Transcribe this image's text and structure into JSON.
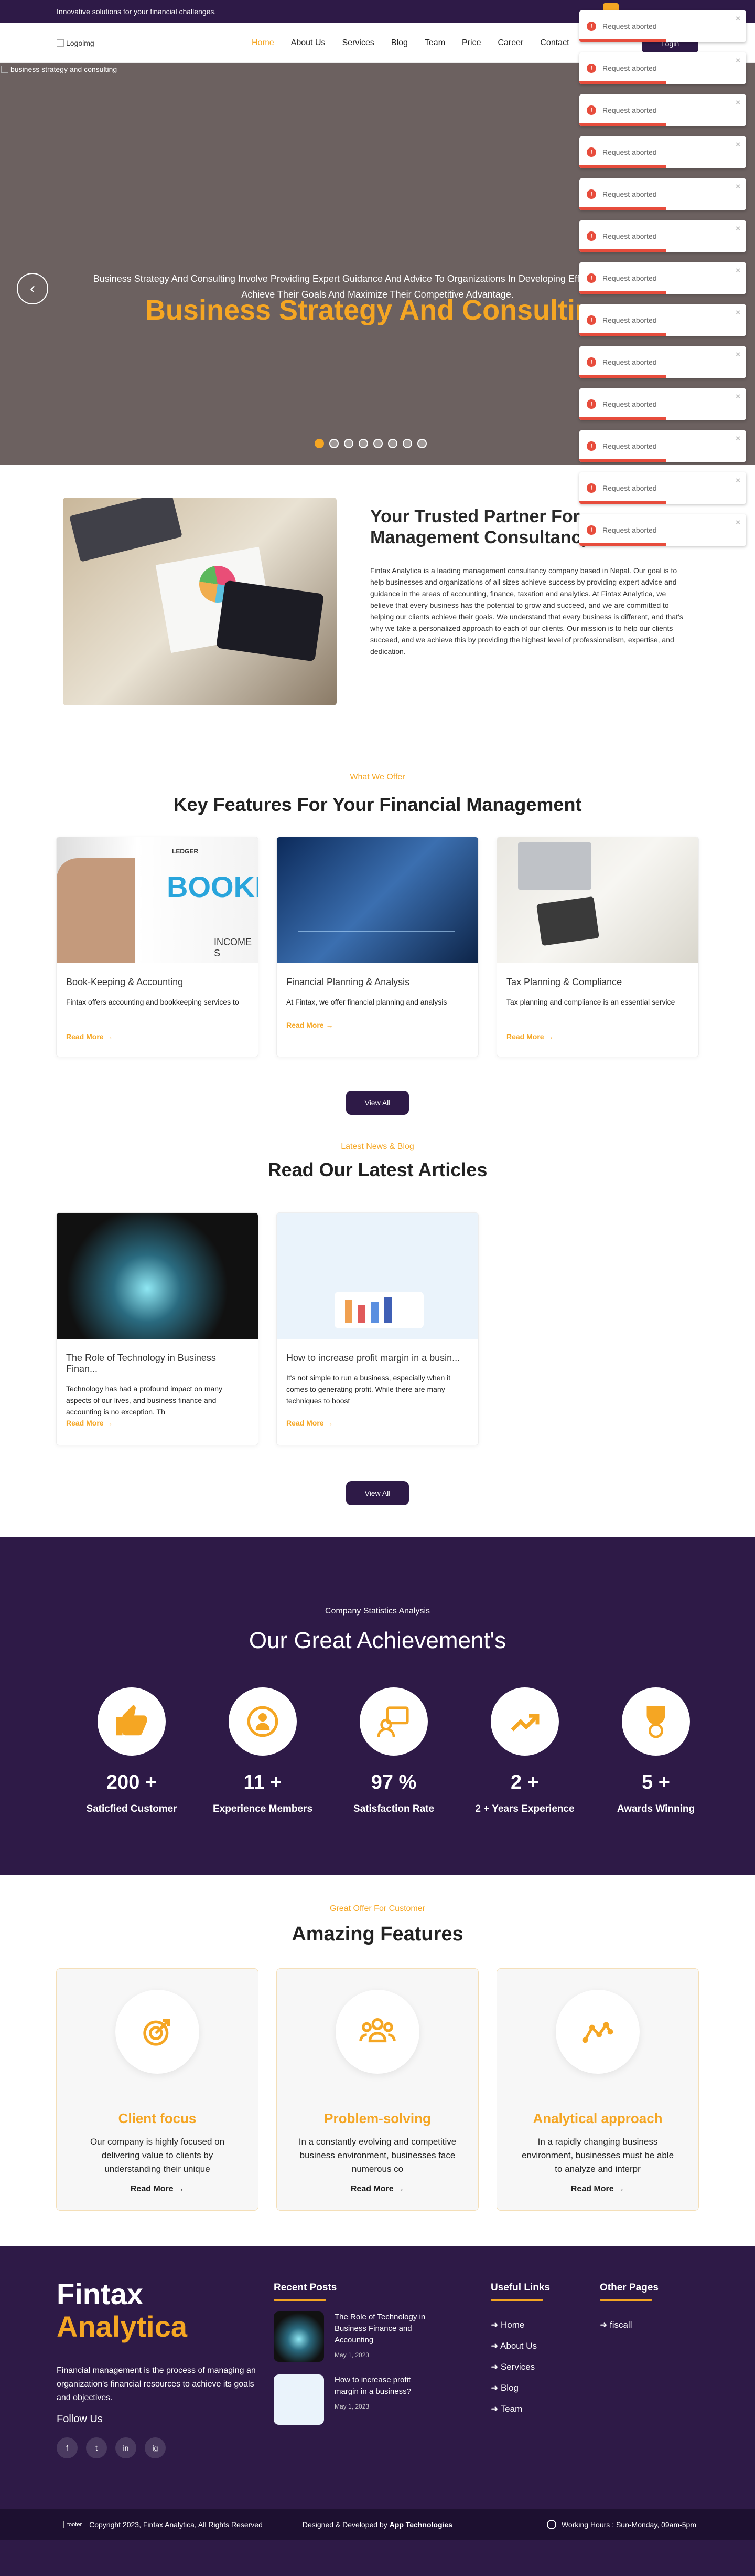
{
  "topbar": {
    "tagline": "Innovative solutions for your financial challenges."
  },
  "header": {
    "logo_alt": "Logoimg",
    "nav": [
      "Home",
      "About Us",
      "Services",
      "Blog",
      "Team",
      "Price",
      "Career",
      "Contact"
    ],
    "login_label": "Login"
  },
  "hero": {
    "image_alt": "business strategy and consulting",
    "title": "Business Strategy And Consulting",
    "subtitle": "Business Strategy And Consulting Involve Providing Expert Guidance And Advice To Organizations In Developing Effective Strategies To Achieve Their Goals And Maximize Their Competitive Advantage.",
    "slide_count": 8,
    "active_slide": 1
  },
  "toasts": {
    "message": "Request aborted",
    "count": 13
  },
  "about": {
    "title": "Your Trusted Partner For Management Consultancy",
    "text": "Fintax Analytica is a leading management consultancy company based in Nepal. Our goal is to help businesses and organizations of all sizes achieve success by providing expert advice and guidance in the areas of accounting, finance, taxation and analytics. At Fintax Analytica, we believe that every business has the potential to grow and succeed, and we are committed to helping our clients achieve their goals. We understand that every business is different, and that's why we take a personalized approach to each of our clients. Our mission is to help our clients succeed, and we achieve this by providing the highest level of professionalism, expertise, and dedication."
  },
  "features": {
    "kicker": "What We Offer",
    "title": "Key Features For Your Financial Management",
    "cards": [
      {
        "title": "Book-Keeping & Accounting",
        "desc": "Fintax offers accounting and bookkeeping services to",
        "img_text": "BOOKKI",
        "img_small": "LEDGER",
        "img_small2": "INCOME S"
      },
      {
        "title": "Financial Planning & Analysis",
        "desc": "At Fintax, we offer financial planning and analysis",
        "img_text": "",
        "img_small": "",
        "img_small2": ""
      },
      {
        "title": "Tax Planning & Compliance",
        "desc": "Tax planning and compliance is an essential service",
        "img_text": "",
        "img_small": "",
        "img_small2": ""
      }
    ],
    "read_more": "Read More",
    "view_all": "View All"
  },
  "blog": {
    "kicker": "Latest News & Blog",
    "title": "Read Our Latest Articles",
    "cards": [
      {
        "title": "The Role of Technology in Business Finan...",
        "desc": "Technology has had a profound impact on many aspects of our lives, and business finance and accounting is no exception. Th"
      },
      {
        "title": "How to increase profit margin in a busin...",
        "desc": "It's not simple to run a business, especially when it comes to generating profit. While there are many techniques to boost"
      }
    ],
    "read_more": "Read More",
    "view_all": "View All"
  },
  "achievements": {
    "kicker": "Company Statistics Analysis",
    "title": "Our Great Achievement's",
    "stats": [
      {
        "value": "200 +",
        "label": "Saticfied Customer",
        "icon": "thumbs-up-icon"
      },
      {
        "value": "11 +",
        "label": "Experience Members",
        "icon": "member-icon"
      },
      {
        "value": "97 %",
        "label": "Satisfaction Rate",
        "icon": "feedback-icon"
      },
      {
        "value": "2 +",
        "label": "2 + Years Experience",
        "icon": "trend-up-icon"
      },
      {
        "value": "5 +",
        "label": "Awards Winning",
        "icon": "award-icon"
      }
    ]
  },
  "amazing": {
    "kicker": "Great Offer For Customer",
    "title": "Amazing Features",
    "cards": [
      {
        "name": "Client focus",
        "desc": "Our company is highly focused on delivering value to clients by understanding their unique",
        "icon": "target-icon"
      },
      {
        "name": "Problem-solving",
        "desc": "In a constantly evolving and competitive business environment, businesses face numerous co",
        "icon": "team-icon"
      },
      {
        "name": "Analytical approach",
        "desc": "In a rapidly changing business environment, businesses must be able to analyze and interpr",
        "icon": "analytics-icon"
      }
    ],
    "read_more": "Read More"
  },
  "footer": {
    "brand_line1": "Fintax",
    "brand_line2": "Analytica",
    "desc": "Financial management is the process of managing an organization's financial resources to achieve its goals and objectives.",
    "follow": "Follow Us",
    "social": [
      "f",
      "t",
      "in",
      "ig"
    ],
    "recent_title": "Recent Posts",
    "posts": [
      {
        "title": "The Role of Technology in Business Finance and Accounting",
        "date": "May 1, 2023"
      },
      {
        "title": "How to increase profit margin in a business?",
        "date": "May 1, 2023"
      }
    ],
    "useful_title": "Useful Links",
    "useful_links": [
      "Home",
      "About Us",
      "Services",
      "Blog",
      "Team"
    ],
    "other_title": "Other Pages",
    "other_links": [
      "fiscall"
    ],
    "logo_alt": "footer",
    "copyright": "Copyright 2023, Fintax Analytica, All Rights Reserved",
    "designed_prefix": "Designed & Developed by ",
    "designed_by": "App Technologies",
    "hours": "Working Hours : Sun-Monday, 09am-5pm"
  },
  "colors": {
    "primary": "#2e1a47",
    "accent": "#f5a623",
    "error": "#e74c3c"
  }
}
